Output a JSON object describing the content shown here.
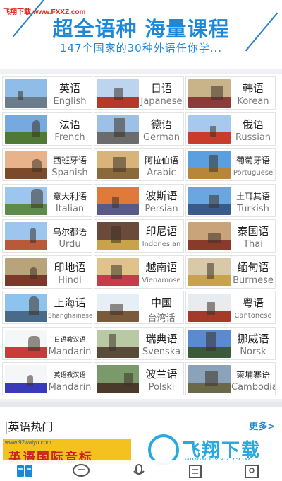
{
  "watermark": "飞翔下载 www.FXXZ.com",
  "banner": {
    "title": "超全语种  海量课程",
    "subtitle": "147个国家的30种外语任你学..."
  },
  "languages": [
    {
      "cn": "英语",
      "en": "English"
    },
    {
      "cn": "日语",
      "en": "Japanese"
    },
    {
      "cn": "韩语",
      "en": "Korean"
    },
    {
      "cn": "法语",
      "en": "French"
    },
    {
      "cn": "德语",
      "en": "German"
    },
    {
      "cn": "俄语",
      "en": "Russian"
    },
    {
      "cn": "西班牙语",
      "en": "Spanish"
    },
    {
      "cn": "阿拉伯语",
      "en": "Arabic"
    },
    {
      "cn": "葡萄牙语",
      "en": "Portuguese"
    },
    {
      "cn": "意大利语",
      "en": "Italian"
    },
    {
      "cn": "波斯语",
      "en": "Persian"
    },
    {
      "cn": "土耳其语",
      "en": "Turkish"
    },
    {
      "cn": "乌尔都语",
      "en": "Urdu"
    },
    {
      "cn": "印尼语",
      "en": "Indonesian"
    },
    {
      "cn": "泰国语",
      "en": "Thai"
    },
    {
      "cn": "印地语",
      "en": "Hindi"
    },
    {
      "cn": "越南语",
      "en": "Vienamose"
    },
    {
      "cn": "缅甸语",
      "en": "Burmese"
    },
    {
      "cn": "上海话",
      "en": "Shanghainese"
    },
    {
      "cn": "中国",
      "en": "台湾话"
    },
    {
      "cn": "粤语",
      "en": "Cantonese"
    },
    {
      "cn": "日语教汉语",
      "en": "Mandarin"
    },
    {
      "cn": "瑞典语",
      "en": "Svenska"
    },
    {
      "cn": "挪威语",
      "en": "Norsk"
    },
    {
      "cn": "英语教汉语",
      "en": "Mandarin"
    },
    {
      "cn": "波兰语",
      "en": "Polski"
    },
    {
      "cn": "柬埔寨语",
      "en": "Cambodia"
    }
  ],
  "hot": {
    "title": "|英语热门",
    "more": "更多>",
    "ad_url": "www.92waiyu.com",
    "ad_text": "英语国际音标"
  },
  "logo": {
    "text": "飞翔下载",
    "url": "WWW.FXXZ.COM"
  },
  "colors": {
    "accent": "#1e88d8",
    "tab_active": "#1e88d8",
    "tab_inactive": "#555555"
  },
  "tabs": [
    {
      "icon": "book-icon",
      "active": true
    },
    {
      "icon": "chat-bubble-icon",
      "active": false
    },
    {
      "icon": "microphone-icon",
      "active": false
    },
    {
      "icon": "list-icon",
      "active": false
    },
    {
      "icon": "profile-icon",
      "active": false
    }
  ]
}
